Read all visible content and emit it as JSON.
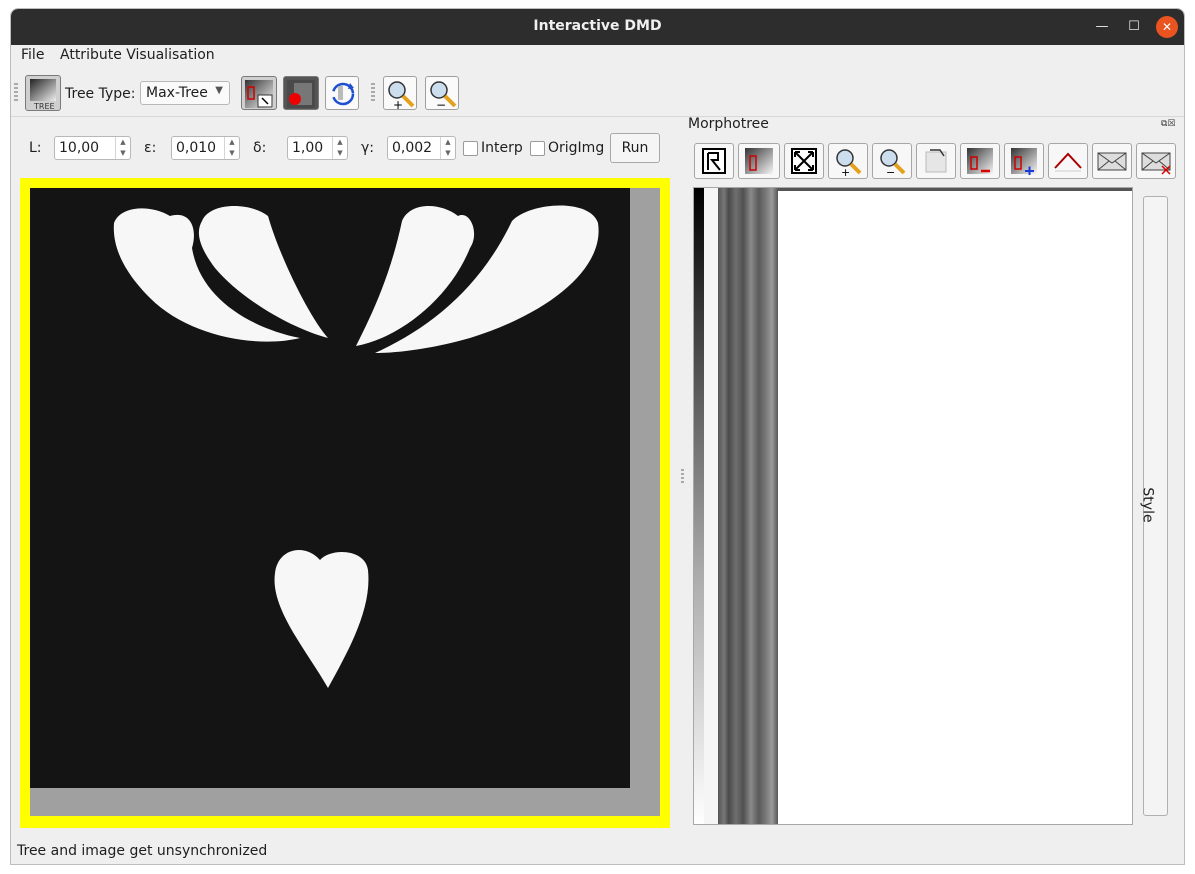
{
  "window": {
    "title": "Interactive DMD"
  },
  "menu": {
    "file": "File",
    "attribute": "Attribute Visualisation"
  },
  "toolbar": {
    "tree_button": "TREE",
    "tree_type_label": "Tree Type:",
    "tree_type_value": "Max-Tree"
  },
  "params": {
    "L_label": "L:",
    "L_value": "10,00",
    "eps_label": "ε:",
    "eps_value": "0,010",
    "delta_label": "δ:",
    "delta_value": "1,00",
    "gamma_label": "γ:",
    "gamma_value": "0,002",
    "interp_label": "Interp",
    "origimg_label": "OrigImg",
    "run_label": "Run"
  },
  "dock": {
    "title": "Morphotree",
    "style_tab": "Style"
  },
  "status": {
    "text": "Tree and image get unsynchronized"
  },
  "colors": {
    "highlight": "#ffff00",
    "titlebar": "#2d2d2d",
    "close": "#e95420",
    "image_bg": "#141414",
    "shapes": "#f7f7f7"
  },
  "icons": {
    "tree": "tree-icon",
    "select_node": "select-node-icon",
    "record": "record-icon",
    "refresh": "refresh-icon",
    "zoom_in": "zoom-in-icon",
    "zoom_out": "zoom-out-icon",
    "fit": "fit-icon",
    "leaf": "leaf-icon",
    "remove": "remove-icon",
    "add": "add-icon",
    "curve": "curve-icon",
    "envelope": "envelope-icon",
    "envelope_remove": "envelope-remove-icon"
  }
}
